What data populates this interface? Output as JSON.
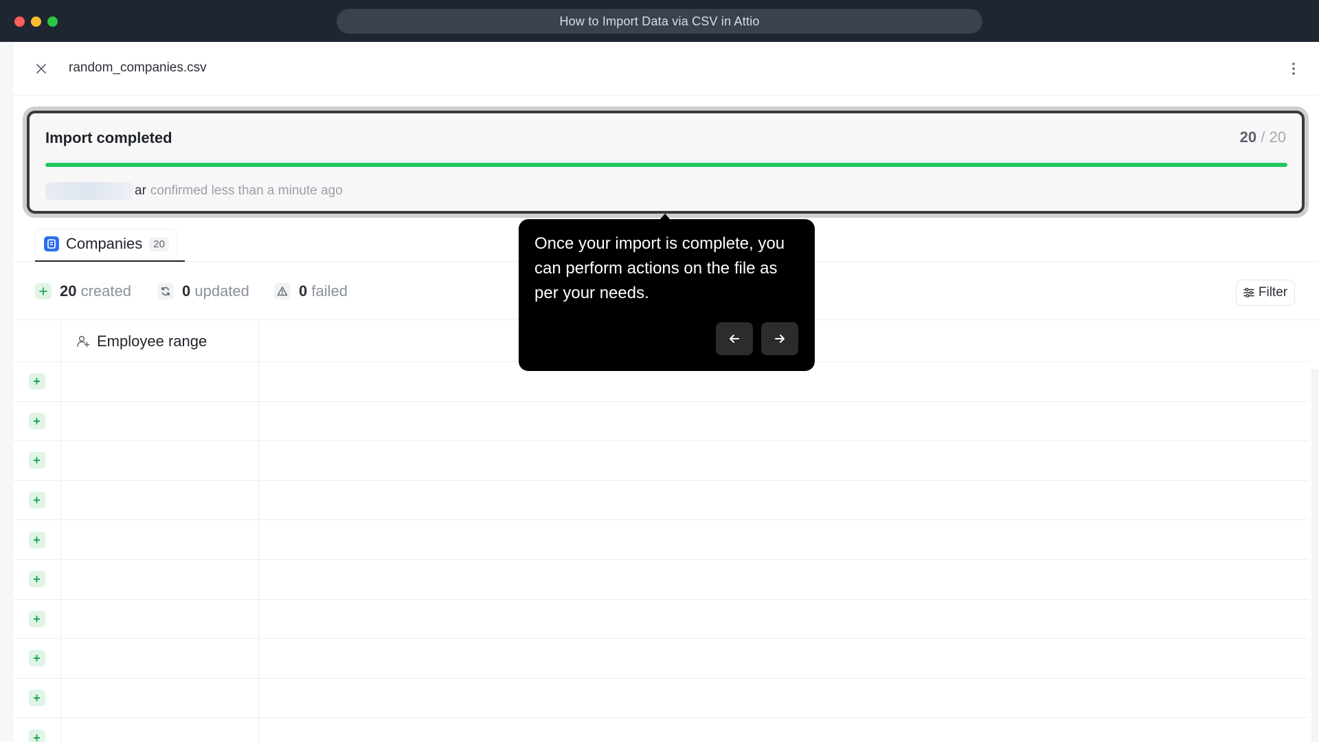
{
  "window": {
    "title": "How to Import Data via CSV in Attio",
    "controls": [
      "close-dot",
      "minimize-dot",
      "zoom-dot"
    ]
  },
  "header": {
    "close_icon": "close-icon",
    "file_name": "random_companies.csv",
    "more_icon": "more-vertical-icon"
  },
  "import": {
    "status": "Import completed",
    "done": "20",
    "separator": "/",
    "total": "20",
    "progress_fraction": 1.0,
    "progress_color": "#22c55e",
    "confirmed_by_visible": "ar",
    "confirmed_text": "confirmed less than a minute ago"
  },
  "tabs": [
    {
      "label": "Companies",
      "count": "20",
      "icon": "companies-icon",
      "active": true
    }
  ],
  "stats": {
    "created": {
      "num": "20",
      "word": "created",
      "icon": "plus-icon",
      "color": "#22a652"
    },
    "updated": {
      "num": "0",
      "word": "updated",
      "icon": "refresh-icon"
    },
    "failed": {
      "num": "0",
      "word": "failed",
      "icon": "warning-icon"
    }
  },
  "filter": {
    "label": "Filter",
    "icon": "sliders-icon"
  },
  "table": {
    "columns": [
      {
        "label": "Employee range",
        "icon": "user-plus-icon"
      }
    ],
    "row_status_icon": "plus-icon",
    "visible_rows": 10
  },
  "tooltip": {
    "text": "Once your import is complete, you can perform actions on the file as per your needs.",
    "prev_icon": "arrow-left-icon",
    "next_icon": "arrow-right-icon"
  },
  "colors": {
    "accent": "#2f6fed",
    "success": "#22c55e",
    "titlebar": "#1f2633"
  }
}
